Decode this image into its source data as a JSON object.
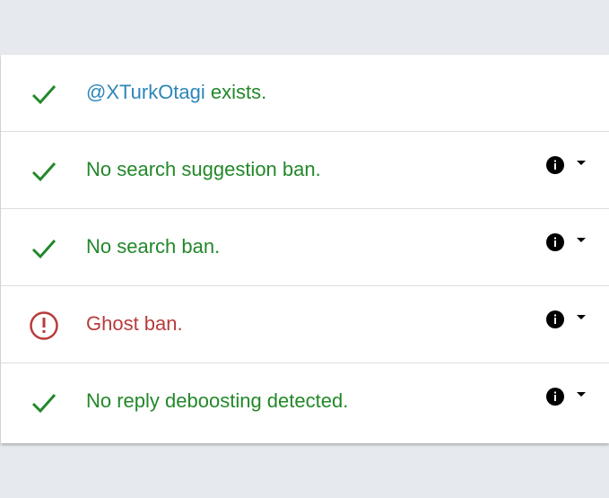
{
  "colors": {
    "ok": "#23882a",
    "warn": "#b83b3b",
    "handle": "#2c86b8",
    "page_bg": "#e6e9ed",
    "card_bg": "#ffffff"
  },
  "results": [
    {
      "status": "ok",
      "icon": "check-icon",
      "handle": "@XTurkOtagi",
      "text": " exists.",
      "has_info": false
    },
    {
      "status": "ok",
      "icon": "check-icon",
      "text": "No search suggestion ban.",
      "has_info": true,
      "info_icon": "info-icon",
      "caret_icon": "caret-down-icon"
    },
    {
      "status": "ok",
      "icon": "check-icon",
      "text": "No search ban.",
      "has_info": true,
      "info_icon": "info-icon",
      "caret_icon": "caret-down-icon"
    },
    {
      "status": "warn",
      "icon": "alert-circle-icon",
      "text": "Ghost ban.",
      "has_info": true,
      "info_icon": "info-icon",
      "caret_icon": "caret-down-icon"
    },
    {
      "status": "ok",
      "icon": "check-icon",
      "text": "No reply deboosting detected.",
      "has_info": true,
      "info_icon": "info-icon",
      "caret_icon": "caret-down-icon"
    }
  ]
}
